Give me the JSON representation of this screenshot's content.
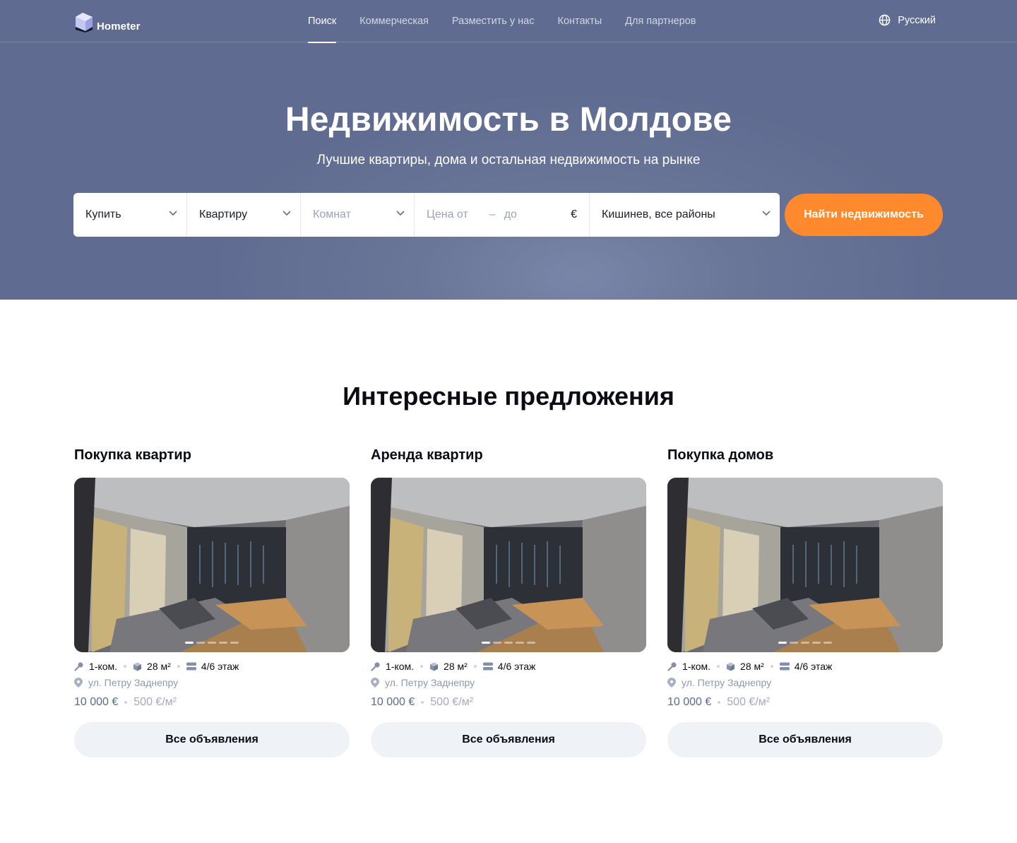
{
  "brand": {
    "name": "Hometer"
  },
  "nav": {
    "items": [
      {
        "label": "Поиск",
        "active": true
      },
      {
        "label": "Коммерческая",
        "active": false
      },
      {
        "label": "Разместить у нас",
        "active": false
      },
      {
        "label": "Контакты",
        "active": false
      },
      {
        "label": "Для партнеров",
        "active": false
      }
    ],
    "language": "Русский"
  },
  "hero": {
    "title": "Недвижимость в Молдове",
    "subtitle": "Лучшие квартиры, дома и остальная недвижимость на рынке"
  },
  "search": {
    "deal": "Купить",
    "type": "Квартиру",
    "rooms_placeholder": "Комнат",
    "price_from_placeholder": "Цена от",
    "price_dash": "–",
    "price_to_placeholder": "до",
    "currency": "€",
    "location": "Кишинев, все районы",
    "submit_label": "Найти недвижимость"
  },
  "offers": {
    "title": "Интересные предложения",
    "cards": [
      {
        "title": "Покупка квартир",
        "rooms": "1-ком.",
        "area": "28 м²",
        "floor": "4/6 этаж",
        "address": "ул. Петру Заднепру",
        "price": "10 000 €",
        "price_per_m2": "500 €/м²",
        "button": "Все объявления"
      },
      {
        "title": "Аренда квартир",
        "rooms": "1-ком.",
        "area": "28 м²",
        "floor": "4/6 этаж",
        "address": "ул. Петру Заднепру",
        "price": "10 000 €",
        "price_per_m2": "500 €/м²",
        "button": "Все объявления"
      },
      {
        "title": "Покупка домов",
        "rooms": "1-ком.",
        "area": "28 м²",
        "floor": "4/6 этаж",
        "address": "ул. Петру Заднепру",
        "price": "10 000 €",
        "price_per_m2": "500 €/м²",
        "button": "Все объявления"
      }
    ]
  },
  "colors": {
    "hero_bg": "#5f6b90",
    "accent": "#ff8a2e",
    "price": "#5a6a92",
    "button_bg": "#eff2f7"
  },
  "icons": [
    "logo-cube-icon",
    "globe-icon",
    "chevron-down-icon",
    "key-icon",
    "cube-area-icon",
    "floors-icon",
    "location-pin-icon"
  ]
}
